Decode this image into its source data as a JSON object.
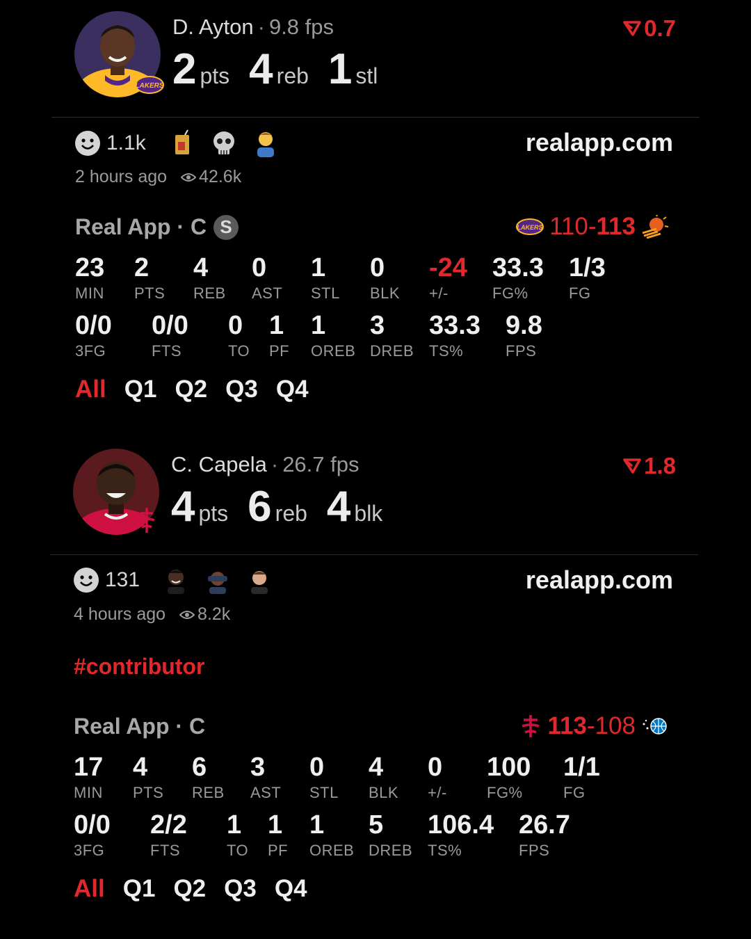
{
  "posts": [
    {
      "player": {
        "name": "D. Ayton",
        "fps": "9.8 fps",
        "team": "lakers",
        "avatar": "player-headshot"
      },
      "headline": [
        {
          "value": "2",
          "unit": "pts"
        },
        {
          "value": "4",
          "unit": "reb"
        },
        {
          "value": "1",
          "unit": "stl"
        }
      ],
      "delta": "0.7",
      "reactions": {
        "count": "1.1k",
        "emojis": [
          "juice-box-emoji",
          "skull-emoji",
          "facepalm-emoji"
        ]
      },
      "site": "realapp.com",
      "time": "2 hours ago",
      "views": "42.6k",
      "hashtag": "",
      "source": {
        "label": "Real App · C",
        "badge": "S"
      },
      "score": {
        "home_logo": "lakers-logo",
        "left": "110",
        "dash": "-",
        "right": "113",
        "away_logo": "suns-logo",
        "bold_side": "right"
      },
      "stats_row1": [
        {
          "value": "23",
          "label": "MIN"
        },
        {
          "value": "2",
          "label": "PTS"
        },
        {
          "value": "4",
          "label": "REB"
        },
        {
          "value": "0",
          "label": "AST"
        },
        {
          "value": "1",
          "label": "STL"
        },
        {
          "value": "0",
          "label": "BLK"
        },
        {
          "value": "-24",
          "label": "+/-",
          "highlight": true
        },
        {
          "value": "33.3",
          "label": "FG%"
        },
        {
          "value": "1/3",
          "label": "FG"
        }
      ],
      "stats_row2": [
        {
          "value": "0/0",
          "label": "3FG"
        },
        {
          "value": "0/0",
          "label": "FTS"
        },
        {
          "value": "0",
          "label": "TO"
        },
        {
          "value": "1",
          "label": "PF"
        },
        {
          "value": "1",
          "label": "OREB"
        },
        {
          "value": "3",
          "label": "DREB"
        },
        {
          "value": "33.3",
          "label": "TS%"
        },
        {
          "value": "9.8",
          "label": "FPS"
        }
      ],
      "tabs": [
        "All",
        "Q1",
        "Q2",
        "Q3",
        "Q4"
      ],
      "active_tab": "All"
    },
    {
      "player": {
        "name": "C. Capela",
        "fps": "26.7 fps",
        "team": "rockets",
        "avatar": "player-headshot"
      },
      "headline": [
        {
          "value": "4",
          "unit": "pts"
        },
        {
          "value": "6",
          "unit": "reb"
        },
        {
          "value": "4",
          "unit": "blk"
        }
      ],
      "delta": "1.8",
      "reactions": {
        "count": "131",
        "emojis": [
          "user-avatar-1",
          "user-avatar-2",
          "user-avatar-3"
        ]
      },
      "site": "realapp.com",
      "time": "4 hours ago",
      "views": "8.2k",
      "hashtag": "#contributor",
      "source": {
        "label": "Real App · C",
        "badge": ""
      },
      "score": {
        "home_logo": "rockets-logo",
        "left": "113",
        "dash": "-",
        "right": "108",
        "away_logo": "magic-logo",
        "bold_side": "left"
      },
      "stats_row1": [
        {
          "value": "17",
          "label": "MIN"
        },
        {
          "value": "4",
          "label": "PTS"
        },
        {
          "value": "6",
          "label": "REB"
        },
        {
          "value": "3",
          "label": "AST"
        },
        {
          "value": "0",
          "label": "STL"
        },
        {
          "value": "4",
          "label": "BLK"
        },
        {
          "value": "0",
          "label": "+/-"
        },
        {
          "value": "100",
          "label": "FG%"
        },
        {
          "value": "1/1",
          "label": "FG"
        }
      ],
      "stats_row2": [
        {
          "value": "0/0",
          "label": "3FG"
        },
        {
          "value": "2/2",
          "label": "FTS"
        },
        {
          "value": "1",
          "label": "TO"
        },
        {
          "value": "1",
          "label": "PF"
        },
        {
          "value": "1",
          "label": "OREB"
        },
        {
          "value": "5",
          "label": "DREB"
        },
        {
          "value": "106.4",
          "label": "TS%"
        },
        {
          "value": "26.7",
          "label": "FPS"
        }
      ],
      "tabs": [
        "All",
        "Q1",
        "Q2",
        "Q3",
        "Q4"
      ],
      "active_tab": "All"
    }
  ],
  "colors": {
    "accent_red": "#e0282d",
    "background": "#000000",
    "lakers_purple": "#552583",
    "lakers_gold": "#FDB927",
    "rockets_red": "#CE1141"
  }
}
